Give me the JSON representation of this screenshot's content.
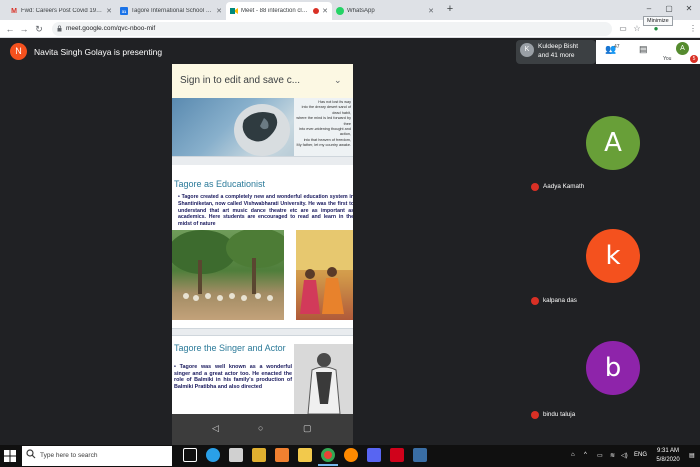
{
  "browser": {
    "tabs": [
      {
        "label": "Fwd: Careers Post Covid 19 - Tag",
        "icon": "gmail-icon",
        "color": "#d93025",
        "glyph": "M"
      },
      {
        "label": "Tagore International School - Cal",
        "icon": "calendar-icon",
        "color": "#1a73e8",
        "glyph": "31"
      },
      {
        "label": "Meet - 88 interaction class8",
        "icon": "meet-icon",
        "color": "#00897b",
        "glyph": "",
        "active": true
      },
      {
        "label": "WhatsApp",
        "icon": "whatsapp-icon",
        "color": "#25d366",
        "glyph": ""
      }
    ],
    "url": "meet.google.com/qvc-nboo-mif",
    "tooltip": "Minimize",
    "profile_initial": "A"
  },
  "meet": {
    "presenter_initial": "N",
    "presenter_text": "Navita Singh Golaya is presenting",
    "people_card": {
      "initial": "K",
      "name": "Kuldeep Bisht",
      "more": "and 41 more"
    },
    "people_count": "47",
    "you_label": "You",
    "you_initial": "A",
    "you_badge": "5",
    "participants": [
      {
        "initial": "A",
        "name": "Aadya Kamath",
        "color": "#689f38"
      },
      {
        "initial": "k",
        "name": "kalpana das",
        "color": "#f4511e"
      },
      {
        "initial": "b",
        "name": "bindu taluja",
        "color": "#8e24aa"
      }
    ]
  },
  "shared_screen": {
    "signin_text": "Sign in to edit and save c...",
    "banner_lines": [
      "Has not lost its way",
      "into the dreary desert sand of dead habit,",
      "where the mind is led forward by thee",
      "into ever-widening thought and action,",
      "into that heaven of freedom,",
      "My father, let my country awake."
    ],
    "section1_title": "Tagore as Educationist",
    "section1_body": "• Tagore created a completely new and wonderful education system in Shantiniketan, now called Vishwabharati University. He was the first to understand that art music dance theatre etc are as important as academics. Here students are encouraged to read and learn in the midst of nature",
    "section2_title": "Tagore the Singer and Actor",
    "section2_body": "• Tagore was well known as a wonderful singer and a great actor too. He enacted the role of Balmiki in his family's production of Balmiki Pratibha and also directed"
  },
  "taskbar": {
    "search_placeholder": "Type here to search",
    "tray_lang": "ENG",
    "time": "9:31 AM",
    "date": "5/8/2020"
  }
}
